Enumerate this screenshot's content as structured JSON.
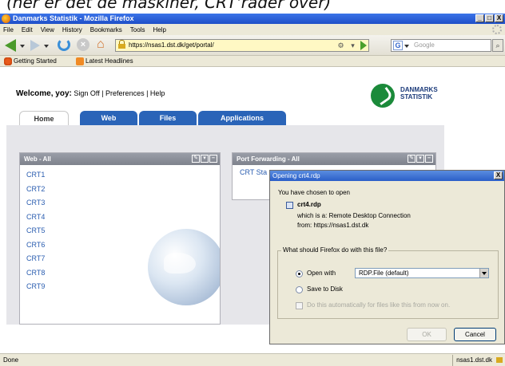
{
  "caption": "(her er det de maskiner, CRT'rader over)",
  "window": {
    "title": "Danmarks Statistik - Mozilla Firefox",
    "min": "_",
    "max": "□",
    "close": "X"
  },
  "menu": [
    "File",
    "Edit",
    "View",
    "History",
    "Bookmarks",
    "Tools",
    "Help"
  ],
  "nav": {
    "url": "https://nsas1.dst.dk/get/portal/",
    "search_placeholder": "Google",
    "search_engine": "G",
    "stop": "×",
    "home": "⌂",
    "search_button": "⌕"
  },
  "bookmarks": [
    "Getting Started",
    "Latest Headlines"
  ],
  "page": {
    "welcome_label": "Welcome, yoy:",
    "welcome_links": "Sign Off | Preferences | Help",
    "logo_line1": "DANMARKS",
    "logo_line2": "STATISTIK",
    "tabs": [
      "Home",
      "Web",
      "Files",
      "Applications"
    ],
    "web_panel": {
      "title": "Web - All",
      "tools": [
        "✎",
        "▾",
        "–"
      ],
      "items": [
        "CRT1",
        "CRT2",
        "CRT3",
        "CRT4",
        "CRT5",
        "CRT6",
        "CRT7",
        "CRT8",
        "CRT9"
      ]
    },
    "pf_panel": {
      "title": "Port Forwarding - All",
      "tools": [
        "✎",
        "▾",
        "–"
      ],
      "item_visible": "CRT Sta"
    }
  },
  "dialog": {
    "title": "Opening crt4.rdp",
    "close": "X",
    "intro": "You have chosen to open",
    "filename": "crt4.rdp",
    "which_is": "which is a:  Remote Desktop Connection",
    "from": "from:  https://nsas1.dst.dk",
    "question": "What should Firefox do with this file?",
    "open_with": "Open with",
    "app": "RDP.File (default)",
    "save": "Save to Disk",
    "auto": "Do this automatically for files like this from now on.",
    "ok": "OK",
    "cancel": "Cancel"
  },
  "status": {
    "text": "Done",
    "host": "nsas1.dst.dk"
  }
}
